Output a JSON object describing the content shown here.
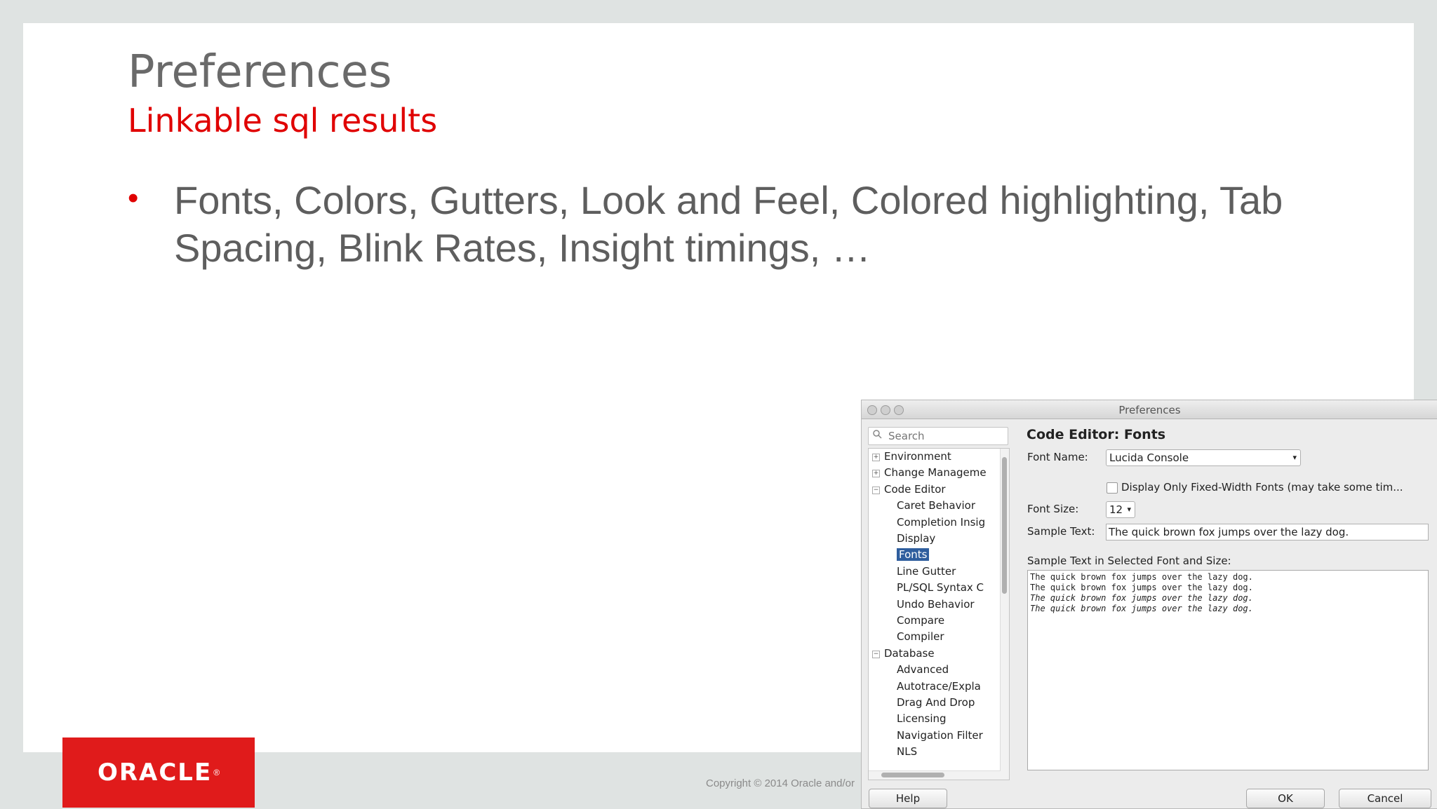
{
  "slide": {
    "title": "Preferences",
    "subtitle": "Linkable sql results",
    "bullet_marker": "•",
    "bullet": "Fonts, Colors, Gutters, Look and Feel, Colored highlighting, Tab Spacing, Blink Rates, Insight timings,  …",
    "logo_text": "ORACLE",
    "logo_mark": "®",
    "copyright": "Copyright © 2014 Oracle and/or",
    "colors": {
      "accent": "#e00000",
      "logo_bg": "#e01b1b",
      "text": "#5e5e5e"
    }
  },
  "dialog": {
    "title": "Preferences",
    "search_placeholder": "Search",
    "search_icon": "search-icon",
    "tree": [
      {
        "label": "Environment",
        "toggle": "+"
      },
      {
        "label": "Change Manageme",
        "toggle": "+"
      },
      {
        "label": "Code Editor",
        "toggle": "−"
      },
      {
        "label": "Caret Behavior"
      },
      {
        "label": "Completion Insig"
      },
      {
        "label": "Display"
      },
      {
        "label": "Fonts",
        "selected": true
      },
      {
        "label": "Line Gutter"
      },
      {
        "label": "PL/SQL Syntax C"
      },
      {
        "label": "Undo Behavior"
      },
      {
        "label": "Compare"
      },
      {
        "label": "Compiler"
      },
      {
        "label": "Database",
        "toggle": "−"
      },
      {
        "label": "Advanced"
      },
      {
        "label": "Autotrace/Expla"
      },
      {
        "label": "Drag And Drop"
      },
      {
        "label": "Licensing"
      },
      {
        "label": "Navigation Filter"
      },
      {
        "label": "NLS"
      }
    ],
    "panel_title": "Code Editor: Fonts",
    "font_name_label": "Font Name:",
    "font_name_value": "Lucida Console",
    "fixed_width_label": "Display Only Fixed-Width Fonts (may take some tim...",
    "font_size_label": "Font Size:",
    "font_size_value": "12",
    "sample_text_label": "Sample Text:",
    "sample_text_value": "The quick brown fox jumps over the lazy dog.",
    "sample_area_label": "Sample Text in Selected Font and Size:",
    "sample_lines": [
      "The quick brown fox jumps over the lazy dog.",
      "The quick brown fox jumps over the lazy dog.",
      "The quick brown fox jumps over the lazy dog.",
      "The quick brown fox jumps over the lazy dog."
    ],
    "help_button": "Help",
    "ok_button": "OK",
    "cancel_button": "Cancel",
    "select_arrow": "▾",
    "selected_color": "#2f5e9e"
  }
}
